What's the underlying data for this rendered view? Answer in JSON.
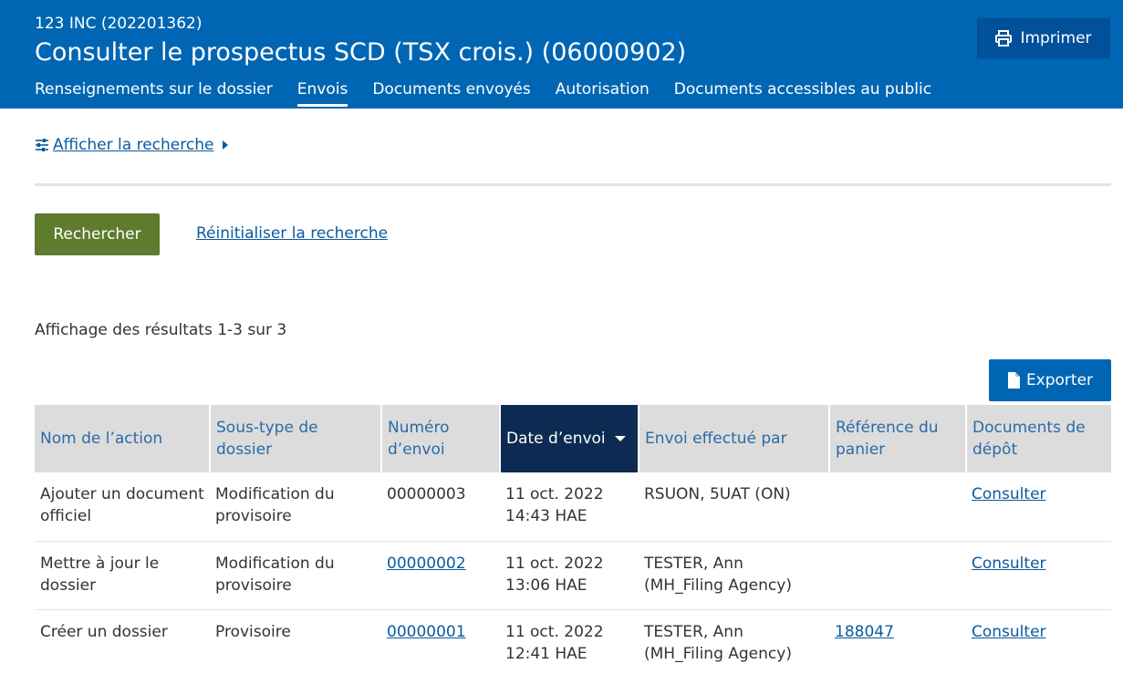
{
  "header": {
    "company": "123 INC (202201362)",
    "title": "Consulter le prospectus SCD (TSX crois.) (06000902)",
    "print_label": "Imprimer",
    "tabs": [
      {
        "label": "Renseignements sur le dossier"
      },
      {
        "label": "Envois"
      },
      {
        "label": "Documents envoyés"
      },
      {
        "label": "Autorisation"
      },
      {
        "label": "Documents accessibles au public"
      }
    ],
    "active_tab": "Envois"
  },
  "search": {
    "toggle_label": "Afficher la recherche",
    "search_label": "Rechercher",
    "reset_label": "Réinitialiser la recherche"
  },
  "results": {
    "summary": "Affichage des résultats 1-3 sur 3",
    "export_label": "Exporter"
  },
  "table": {
    "columns": [
      "Nom de l’action",
      "Sous-type de dossier",
      "Numéro d’envoi",
      "Date d’envoi",
      "Envoi effectué par",
      "Référence du panier",
      "Documents de dépôt"
    ],
    "rows": [
      {
        "action": "Ajouter un document officiel",
        "subtype": "Modification du provisoire",
        "number": "00000003",
        "date": "11 oct. 2022",
        "time": "14:43 HAE",
        "by": "RSUON, 5UAT (ON)",
        "cart": "",
        "docs": "Consulter"
      },
      {
        "action": "Mettre à jour le dossier",
        "subtype": "Modification du provisoire",
        "number": "00000002",
        "date": "11 oct. 2022",
        "time": "13:06 HAE",
        "by": "TESTER, Ann (MH_Filing Agency)",
        "cart": "",
        "docs": "Consulter"
      },
      {
        "action": "Créer un dossier",
        "subtype": "Provisoire",
        "number": "00000001",
        "date": "11 oct. 2022",
        "time": "12:41 HAE",
        "by": "TESTER, Ann (MH_Filing Agency)",
        "cart": "188047",
        "docs": "Consulter"
      }
    ]
  },
  "colors": {
    "header_bg": "#0066b3",
    "print_bg": "#00509a",
    "search_btn": "#5f7c2e",
    "sorted_header": "#0d2b52",
    "link": "#0a5a9e"
  },
  "icons": {
    "print": "printer-icon",
    "search_toggle": "sliders-icon",
    "export": "file-icon",
    "sort": "caret-down-icon"
  }
}
